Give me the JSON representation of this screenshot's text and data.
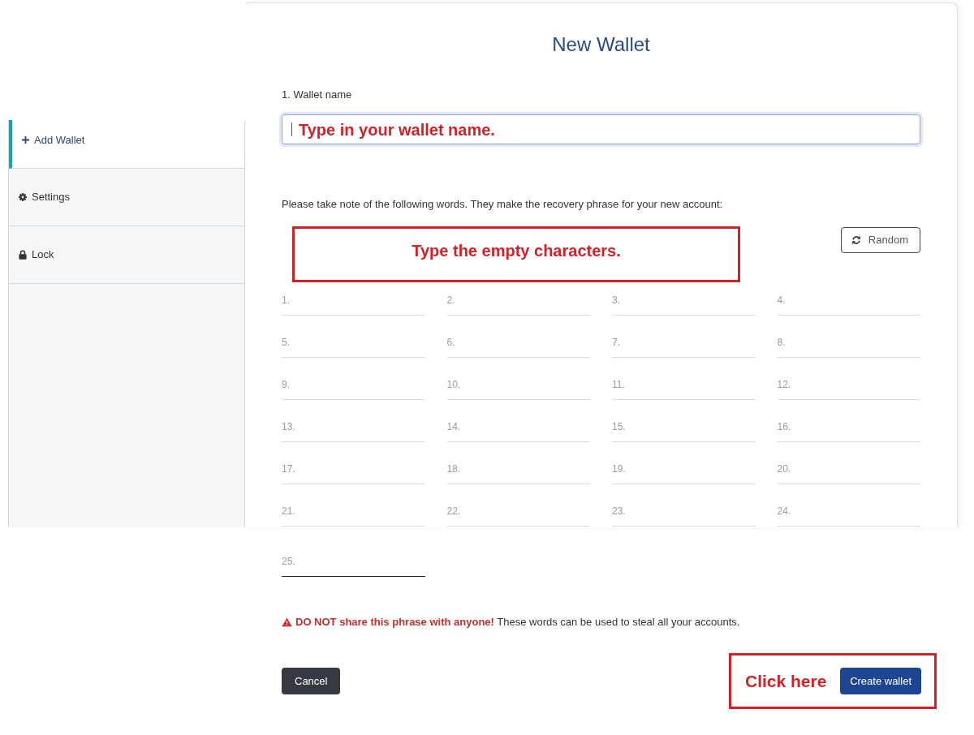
{
  "sidebar": {
    "items": [
      {
        "kind": "add",
        "label": "Add Wallet",
        "selected": true
      },
      {
        "kind": "settings",
        "label": "Settings",
        "selected": false
      },
      {
        "kind": "lock",
        "label": "Lock",
        "selected": false
      }
    ]
  },
  "form": {
    "title": "New Wallet",
    "wallet_name": {
      "label": "1. Wallet name",
      "focused": true,
      "annotation": "Type in your wallet name."
    },
    "recovery": {
      "instruction": "Please take note of the following words. They make the recovery phrase for your new account:",
      "annotation": "Type the empty characters.",
      "random_button": "Random",
      "words": [
        {
          "label": "1.",
          "focused": false
        },
        {
          "label": "2.",
          "focused": false
        },
        {
          "label": "3.",
          "focused": false
        },
        {
          "label": "4.",
          "focused": false
        },
        {
          "label": "5.",
          "focused": false
        },
        {
          "label": "6.",
          "focused": false
        },
        {
          "label": "7.",
          "focused": false
        },
        {
          "label": "8.",
          "focused": false
        },
        {
          "label": "9.",
          "focused": false
        },
        {
          "label": "10.",
          "focused": false
        },
        {
          "label": "11.",
          "focused": false
        },
        {
          "label": "12.",
          "focused": false
        },
        {
          "label": "13.",
          "focused": false
        },
        {
          "label": "14.",
          "focused": false
        },
        {
          "label": "15.",
          "focused": false
        },
        {
          "label": "16.",
          "focused": false
        },
        {
          "label": "17.",
          "focused": false
        },
        {
          "label": "18.",
          "focused": false
        },
        {
          "label": "19.",
          "focused": false
        },
        {
          "label": "20.",
          "focused": false
        },
        {
          "label": "21.",
          "focused": false
        },
        {
          "label": "22.",
          "focused": false
        },
        {
          "label": "23.",
          "focused": false
        },
        {
          "label": "24.",
          "focused": false
        },
        {
          "label": "25.",
          "focused": true
        }
      ]
    },
    "warning": "**DO NOT share this phrase with anyone!** These words can be used to steal all your accounts.",
    "actions": {
      "cancel": "Cancel",
      "create": "Create wallet",
      "annotation": "Click here"
    }
  }
}
